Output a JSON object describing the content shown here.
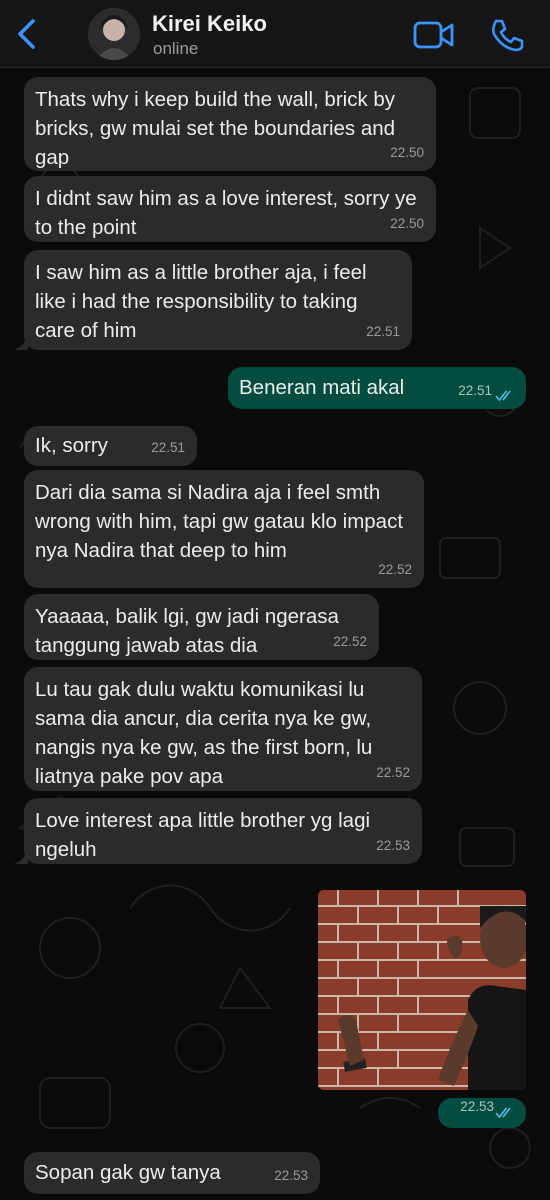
{
  "header": {
    "contact_name": "Kirei Keiko",
    "status": "online",
    "accent_color": "#3b95ff"
  },
  "messages": [
    {
      "direction": "incoming",
      "text": "Thats why i keep build the wall, brick by bricks, gw mulai set the boundaries and gap",
      "time": "22.50"
    },
    {
      "direction": "incoming",
      "text": "I didnt saw him as a love interest, sorry ye to the point",
      "time": "22.50"
    },
    {
      "direction": "incoming",
      "text": "I saw him as a little brother aja, i feel like i had the responsibility to taking care of him",
      "time": "22.51"
    },
    {
      "direction": "outgoing",
      "text": "Beneran mati akal",
      "time": "22.51",
      "read": true
    },
    {
      "direction": "incoming",
      "text": "Ik, sorry",
      "time": "22.51"
    },
    {
      "direction": "incoming",
      "text": "Dari dia sama si Nadira aja i feel smth wrong with him, tapi gw gatau klo impact nya Nadira that deep to him",
      "time": "22.52"
    },
    {
      "direction": "incoming",
      "text": "Yaaaaa, balik lgi, gw jadi ngerasa tanggung jawab atas dia",
      "time": "22.52"
    },
    {
      "direction": "incoming",
      "text": "Lu tau gak dulu waktu komunikasi lu sama dia ancur, dia cerita nya ke gw, nangis nya ke gw, as the first born, lu liatnya pake pov apa",
      "time": "22.52"
    },
    {
      "direction": "incoming",
      "text": "Love interest apa little brother yg lagi ngeluh",
      "time": "22.53"
    },
    {
      "direction": "outgoing",
      "type": "image",
      "image_desc": "man talking to brick wall meme",
      "time": "22.53",
      "read": true
    },
    {
      "direction": "incoming",
      "text": "Sopan gak gw tanya",
      "time": "22.53"
    }
  ],
  "colors": {
    "incoming_bubble": "#2b2b2d",
    "outgoing_bubble": "#054c40",
    "read_ticks": "#53bdeb"
  }
}
